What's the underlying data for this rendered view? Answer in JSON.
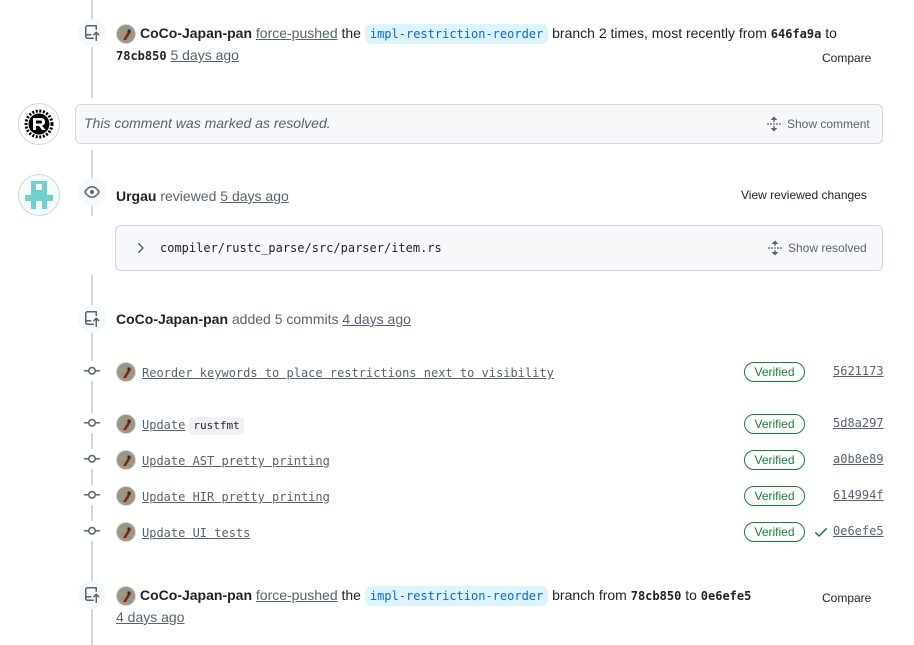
{
  "events": {
    "push1": {
      "author": "CoCo-Japan-pan",
      "action": "force-pushed",
      "the": "the",
      "branch": "impl-restriction-reorder",
      "middle": "branch 2 times, most recently from",
      "from_sha": "646fa9a",
      "to": "to",
      "to_sha": "78cb850",
      "time": "5 days ago",
      "compare": "Compare"
    },
    "resolved": {
      "text": "This comment was marked as resolved.",
      "button": "Show comment"
    },
    "review": {
      "author": "Urgau",
      "action": "reviewed",
      "time": "5 days ago",
      "view_button": "View reviewed changes",
      "file_path": "compiler/rustc_parse/src/parser/item.rs",
      "show_resolved": "Show resolved"
    },
    "commits_header": {
      "author": "CoCo-Japan-pan",
      "action": "added 5 commits",
      "time": "4 days ago"
    },
    "commits": [
      {
        "message": "Reorder keywords to place restrictions next to visibility",
        "code": "",
        "status": "Verified",
        "sha": "5621173",
        "check": false
      },
      {
        "message": "Update",
        "code": "rustfmt",
        "status": "Verified",
        "sha": "5d8a297",
        "check": false
      },
      {
        "message": "Update AST pretty printing",
        "code": "",
        "status": "Verified",
        "sha": "a0b8e89",
        "check": false
      },
      {
        "message": "Update HIR pretty printing",
        "code": "",
        "status": "Verified",
        "sha": "614994f",
        "check": false
      },
      {
        "message": "Update UI tests",
        "code": "",
        "status": "Verified",
        "sha": "0e6efe5",
        "check": true
      }
    ],
    "push2": {
      "author": "CoCo-Japan-pan",
      "action": "force-pushed",
      "the": "the",
      "branch": "impl-restriction-reorder",
      "middle": "branch from",
      "from_sha": "78cb850",
      "to": "to",
      "to_sha": "0e6efe5",
      "time": "4 days ago",
      "compare": "Compare"
    }
  },
  "icons": {
    "push": "repo-push-icon",
    "eye": "eye-icon",
    "commit": "git-commit-icon",
    "unfold": "unfold-icon",
    "chevron": "chevron-right-icon",
    "check": "check-icon"
  },
  "colors": {
    "verified": "#1a7f37",
    "branch_bg": "#ddf4ff",
    "branch_fg": "#0969da",
    "muted": "#59636e",
    "border": "#d0d7de"
  }
}
